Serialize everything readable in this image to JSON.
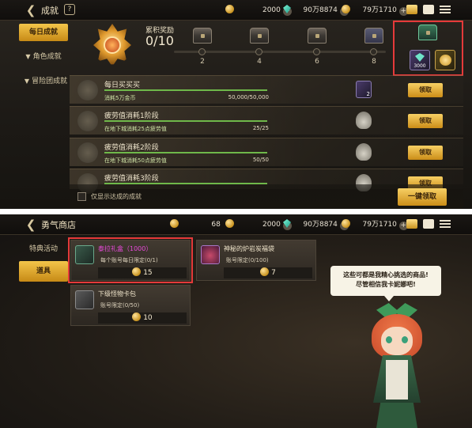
{
  "achievements": {
    "title": "成就",
    "help_icon": "?",
    "currency": {
      "gold": "2000",
      "gems": "90万8874",
      "coins": "79万1710"
    },
    "sidebar": [
      {
        "label": "每日成就",
        "active": true
      },
      {
        "label": "角色成就",
        "active": false
      },
      {
        "label": "冒险团成就",
        "active": false
      }
    ],
    "reward": {
      "label": "累积奖励",
      "progress": "0/10",
      "milestones": [
        "2",
        "4",
        "6",
        "8"
      ],
      "final_reward_count": "3000"
    },
    "rows": [
      {
        "title": "每日买买买",
        "desc": "消耗5万金币",
        "progress": "50,000/50,000",
        "item_count": "2",
        "button": "领取",
        "complete": true
      },
      {
        "title": "疲劳值消耗1阶段",
        "desc": "在地下城消耗25点疲劳值",
        "progress": "25/25",
        "item_count": "",
        "button": "领取",
        "complete": true
      },
      {
        "title": "疲劳值消耗2阶段",
        "desc": "在地下城消耗50点疲劳值",
        "progress": "50/50",
        "item_count": "",
        "button": "领取",
        "complete": true
      },
      {
        "title": "疲劳值消耗3阶段",
        "desc": "",
        "progress": "",
        "item_count": "",
        "button": "领取",
        "complete": true
      }
    ],
    "checkbox_label": "仅显示达成的成就",
    "claim_all": "一键领取"
  },
  "shop": {
    "title": "勇气商店",
    "currency": {
      "shop_coin": "68",
      "gold": "2000",
      "gems": "90万8874",
      "coins": "79万1710"
    },
    "sidebar": [
      {
        "label": "特典活动",
        "active": false
      },
      {
        "label": "道具",
        "active": true
      }
    ],
    "items": [
      {
        "name": "泰拉礼盒（1000）",
        "limit": "每个账号每日限定(0/1)",
        "price": "15"
      },
      {
        "name": "神秘的炉岩炭福袋",
        "limit": "账号限定(0/100)",
        "price": "7"
      },
      {
        "name": "下级怪物卡包",
        "limit": "账号限定(0/50)",
        "price": "10"
      }
    ],
    "npc_line1": "这些可都是我精心挑选的商品!",
    "npc_line2": "尽管相信我卡妮娜吧!"
  },
  "colors": {
    "accent": "#f1c04a",
    "highlight": "#e53a3a",
    "progress": "#6fb84a",
    "item_pink": "#e64ad8"
  }
}
